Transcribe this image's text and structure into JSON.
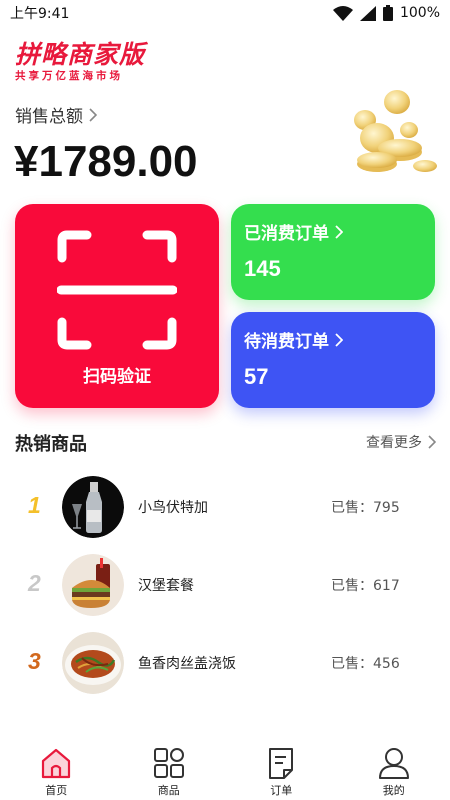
{
  "status_bar": {
    "time": "上午9:41",
    "battery": "100%"
  },
  "brand": {
    "title": "拼略商家版",
    "subtitle": "共享万亿蓝海市场"
  },
  "sales": {
    "label": "销售总额",
    "amount": "¥1789.00"
  },
  "scan": {
    "label": "扫码验证"
  },
  "cards": {
    "consumed": {
      "title": "已消费订单",
      "value": "145"
    },
    "pending": {
      "title": "待消费订单",
      "value": "57"
    }
  },
  "hot": {
    "title": "热销商品",
    "see_more": "查看更多",
    "items": [
      {
        "rank": "1",
        "name": "小鸟伏特加",
        "sold": "已售：795",
        "rank_color": "#f4c02a"
      },
      {
        "rank": "2",
        "name": "汉堡套餐",
        "sold": "已售：617",
        "rank_color": "#c8c8c8"
      },
      {
        "rank": "3",
        "name": "鱼香肉丝盖浇饭",
        "sold": "已售：456",
        "rank_color": "#d2691e"
      }
    ]
  },
  "tabs": [
    {
      "label": "首页",
      "icon": "home-icon"
    },
    {
      "label": "商品",
      "icon": "grid-icon"
    },
    {
      "label": "订单",
      "icon": "order-icon"
    },
    {
      "label": "我的",
      "icon": "user-icon"
    }
  ],
  "colors": {
    "brand": "#e8193c",
    "scan": "#f90a3a",
    "green": "#34de4e",
    "blue": "#3e54f4"
  }
}
